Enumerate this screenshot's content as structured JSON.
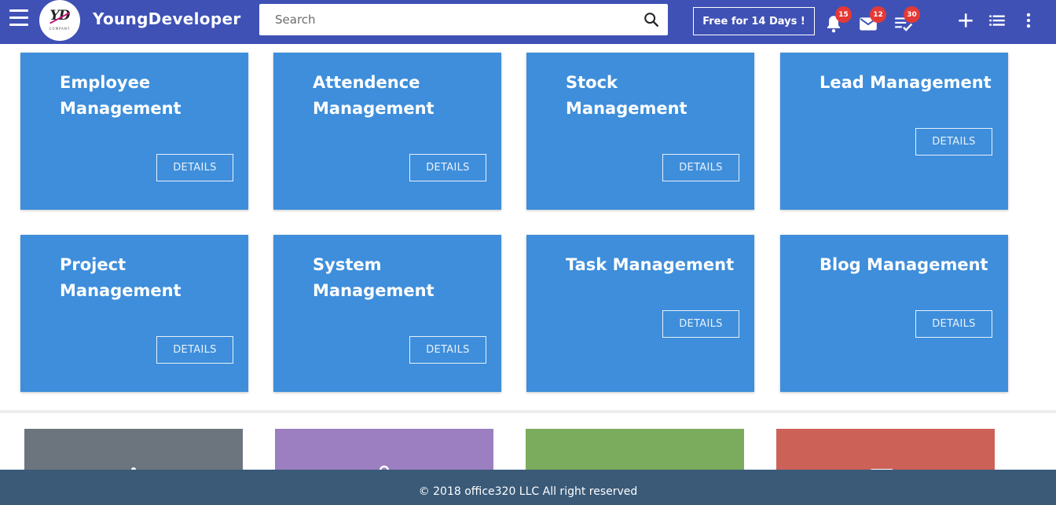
{
  "header": {
    "brand": "YoungDeveloper",
    "logo_text": "YD",
    "logo_subtext": "COMPANY",
    "search_placeholder": "Search",
    "trial_label": "Free for 14 Days !",
    "notifications_count": "15",
    "messages_count": "12",
    "tasks_count": "30",
    "color": "#3f51b5"
  },
  "cards": [
    {
      "title": "Employee Management",
      "button": "DETAILS"
    },
    {
      "title": "Attendence Management",
      "button": "DETAILS"
    },
    {
      "title": "Stock Management",
      "button": "DETAILS"
    },
    {
      "title": "Lead Management",
      "button": "DETAILS"
    },
    {
      "title": "Project Management",
      "button": "DETAILS"
    },
    {
      "title": "System Management",
      "button": "DETAILS"
    },
    {
      "title": "Task Management",
      "button": "DETAILS"
    },
    {
      "title": "Blog Management",
      "button": "DETAILS"
    }
  ],
  "card_color": "#3e8edb",
  "stat_tiles": [
    {
      "color": "#6c757d",
      "icon": "user-icon"
    },
    {
      "color": "#9b7fc0",
      "icon": "location-pin-icon"
    },
    {
      "color": "#7bab5c",
      "icon": "envelope-icon"
    },
    {
      "color": "#cc6158",
      "icon": "envelope-icon"
    }
  ],
  "footer": {
    "text": "© 2018 office320 LLC All right reserved",
    "color": "#3a5a78"
  }
}
